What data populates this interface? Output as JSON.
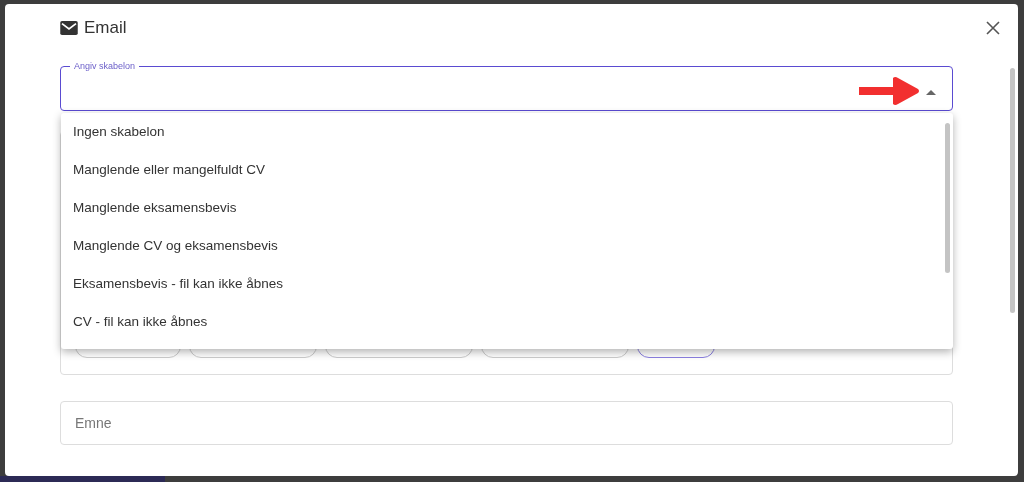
{
  "dialog": {
    "title": "Email",
    "template_select": {
      "label": "Angiv skabelon",
      "expanded": true
    },
    "menu": {
      "items": [
        {
          "label": "Ingen skabelon"
        },
        {
          "label": "Manglende eller mangelfuldt CV"
        },
        {
          "label": "Manglende eksamensbevis"
        },
        {
          "label": "Manglende CV og eksamensbevis"
        },
        {
          "label": "Eksamensbevis - fil kan ikke åbnes"
        },
        {
          "label": "CV - fil kan ikke åbnes"
        }
      ]
    },
    "chips": [
      {
        "selected": false
      },
      {
        "selected": false
      },
      {
        "selected": false
      },
      {
        "selected": false
      },
      {
        "selected": true
      }
    ],
    "subject": {
      "placeholder": "Emne"
    }
  }
}
